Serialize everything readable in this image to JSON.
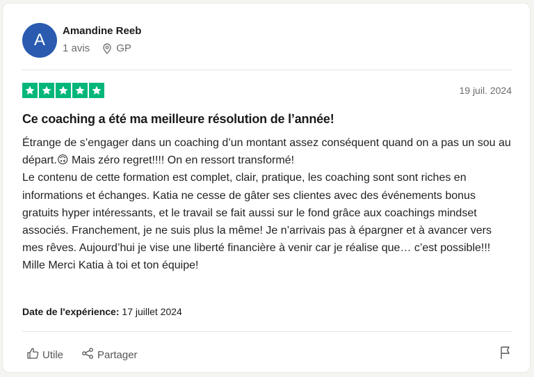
{
  "review": {
    "author": {
      "initial": "A",
      "name": "Amandine Reeb",
      "reviews_count": "1 avis",
      "country": "GP",
      "avatar_color": "#2a5bb0"
    },
    "rating": 5,
    "star_color": "#00b67a",
    "date": "19 juil. 2024",
    "title": "Ce coaching a été ma meilleure résolution de l’année!",
    "body_lines": [
      "Étrange de s’engager dans un coaching d’un montant assez conséquent quand on a pas un sou au départ.🙃 Mais zéro regret!!!! On en ressort transformé!",
      "Le contenu de cette formation est complet, clair, pratique, les coaching sont sont riches en informations et échanges. Katia ne cesse de gâter ses clientes avec des événements bonus gratuits hyper intéressants, et le travail se fait aussi sur le fond grâce aux coachings mindset associés. Franchement, je ne suis plus la même! Je n’arrivais pas à épargner et à avancer vers mes rêves. Aujourd’hui je vise une liberté financière à venir car je réalise que… c’est possible!!!",
      "Mille Merci Katia à toi et ton équipe!"
    ],
    "experience_label": "Date de l'expérience:",
    "experience_date": "17 juillet 2024"
  },
  "actions": {
    "useful_label": "Utile",
    "share_label": "Partager"
  },
  "icons": [
    "location-pin-icon",
    "star-icon",
    "thumbs-up-icon",
    "share-icon",
    "flag-icon"
  ]
}
